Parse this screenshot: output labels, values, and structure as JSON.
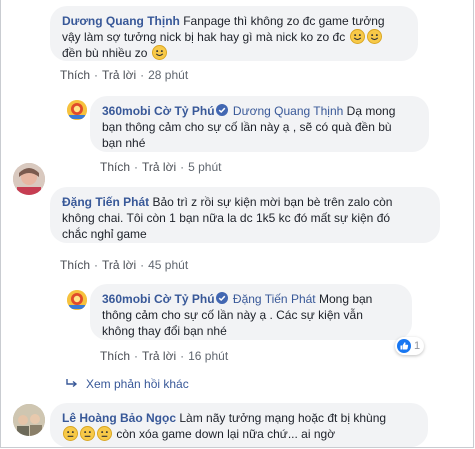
{
  "comments": [
    {
      "author": "Dương Quang Thịnh",
      "text_1": "Fanpage thì không zo đc game tưởng",
      "text_2": "vậy làm sợ tưởng nick bị hak hay gì mà nick ko zo đc",
      "text_3": "đền bù nhiều zo",
      "like": "Thích",
      "reply": "Trả lời",
      "time": "28 phút"
    },
    {
      "author": "360mobi Cờ Tỷ Phú",
      "mention": "Dương Quang Thịnh",
      "text_1": "Dạ mong",
      "text_2": "bạn thông cảm cho sự cố lần này ạ , sẽ có quà đền bù",
      "text_3": "bạn nhé",
      "like": "Thích",
      "reply": "Trả lời",
      "time": "5 phút"
    },
    {
      "author": "Đặng Tiến Phát",
      "text_1": "Bảo trì z rồi sự kiện mời bạn bè trên zalo còn",
      "text_2": "không chai. Tôi còn 1 bạn nữa la dc 1k5 kc đó mất sự kiện đó",
      "text_3": "chắc nghỉ game",
      "like": "Thích",
      "reply": "Trả lời",
      "time": "45 phút"
    },
    {
      "author": "360mobi Cờ Tỷ Phú",
      "mention": "Đặng Tiến Phát",
      "text_1": "Mong bạn",
      "text_2": "thông cảm cho sự cố lần này ạ . Các sự kiện vẫn",
      "text_3": "không thay đổi bạn nhé",
      "like": "Thích",
      "reply": "Trả lời",
      "time": "16 phút",
      "reaction_count": "1"
    },
    {
      "author": "Lê Hoàng Bảo Ngọc",
      "text_1": "Làm nãy tưởng mạng hoặc đt bị khùng",
      "text_2": "còn xóa game down lại nữa chứ... ai ngờ"
    }
  ],
  "more_replies": "Xem phản hồi khác",
  "colors": {
    "link": "#385898",
    "bubble": "#f2f3f5",
    "verified": "#4267b2",
    "like_blue": "#1877f2"
  },
  "icons": [
    "smile-emoji-icon",
    "neutral-emoji-icon",
    "verified-badge-icon",
    "like-reaction-icon",
    "reply-arrow-icon"
  ]
}
